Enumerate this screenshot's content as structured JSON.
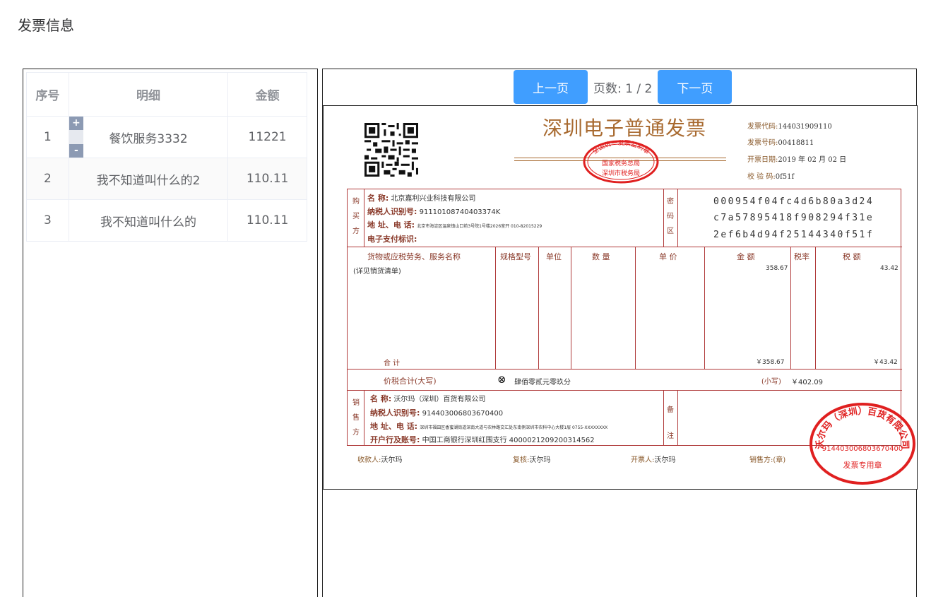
{
  "page": {
    "title": "发票信息"
  },
  "table": {
    "headers": {
      "index": "序号",
      "detail": "明细",
      "amount": "金额"
    },
    "rows": [
      {
        "index": "1",
        "detail": "餐饮服务3332",
        "amount": "11221"
      },
      {
        "index": "2",
        "detail": "我不知道叫什么的2",
        "amount": "110.11"
      },
      {
        "index": "3",
        "detail": "我不知道叫什么的",
        "amount": "110.11"
      }
    ],
    "controls": {
      "plus": "+",
      "minus": "-"
    }
  },
  "pager": {
    "prev_label": "上一页",
    "next_label": "下一页",
    "page_info": "页数: 1 / 2"
  },
  "invoice": {
    "title": "深圳电子普通发票",
    "seal_top": {
      "line1": "全国统一发票监制章",
      "line2": "国家税务总局",
      "line3": "深圳市税务局"
    },
    "meta": {
      "code_label": "发票代码:",
      "code": "144031909110",
      "number_label": "发票号码:",
      "number": "00418811",
      "date_label": "开票日期:",
      "date": "2019 年 02 月 02 日",
      "check_label": "校 验 码:",
      "check": "0f51f"
    },
    "buyer": {
      "side_label": [
        "购",
        "买",
        "方"
      ],
      "name_label": "名            称:",
      "name": "北京嘉利兴业科技有限公司",
      "tax_label": "纳税人识别号:",
      "tax": "91110108740403374K",
      "addr_label": "地 址、电 话:",
      "addr": "北京市海淀区温泉镇山口前3号院1号楼2026室开 010-82015229",
      "pay_label": "电子支付标识:"
    },
    "password": {
      "side_label": [
        "密",
        "码",
        "区"
      ],
      "line1": "000954f04fc4d6b80a3d24",
      "line2": "c7a57895418f908294f31e",
      "line3": "2ef6b4d94f25144340f51f"
    },
    "items": {
      "headers": [
        "货物或应税劳务、服务名称",
        "规格型号",
        "单位",
        "数  量",
        "单  价",
        "金    额",
        "税率",
        "税    额"
      ],
      "name": "(详见销货清单)",
      "amount": "358.67",
      "tax": "43.42",
      "total_label": "合          计",
      "total_amount": "￥358.67",
      "total_tax": "￥43.42"
    },
    "grand_total": {
      "label": "价税合计(大写)",
      "icon": "⊗",
      "upper": "肆佰零贰元零玖分",
      "lower_label": "(小写)",
      "lower": "￥402.09"
    },
    "seller": {
      "side_label": [
        "销",
        "售",
        "方"
      ],
      "name_label": "名            称:",
      "name": "沃尔玛（深圳）百货有限公司",
      "tax_label": "纳税人识别号:",
      "tax": "914403006803670400",
      "addr_label": "地 址、电 话:",
      "addr": "深圳市福田区香蜜湖街道深南大道与农林路交汇处东南侧深圳市农科中心大楼1层 0755-XXXXXXXX",
      "bank_label": "开户行及账号:",
      "bank": "中国工商银行深圳红围支行 4000021209200314562"
    },
    "remark": {
      "side_label": [
        "备",
        "注"
      ]
    },
    "seal_bottom": {
      "line1": "沃尔玛（深圳）百货有限公司",
      "line2": "914403006803670400",
      "line3": "发票专用章"
    },
    "footer": {
      "payee_label": "收款人:",
      "payee": "沃尔玛",
      "reviewer_label": "复核:",
      "reviewer": "沃尔玛",
      "issuer_label": "开票人:",
      "issuer": "沃尔玛",
      "seller_label": "销售方:(章)"
    }
  },
  "colors": {
    "accent": "#409eff",
    "invoice_text": "#8a5a2b",
    "seal_red": "#e02020",
    "border": "#b03a3a"
  }
}
